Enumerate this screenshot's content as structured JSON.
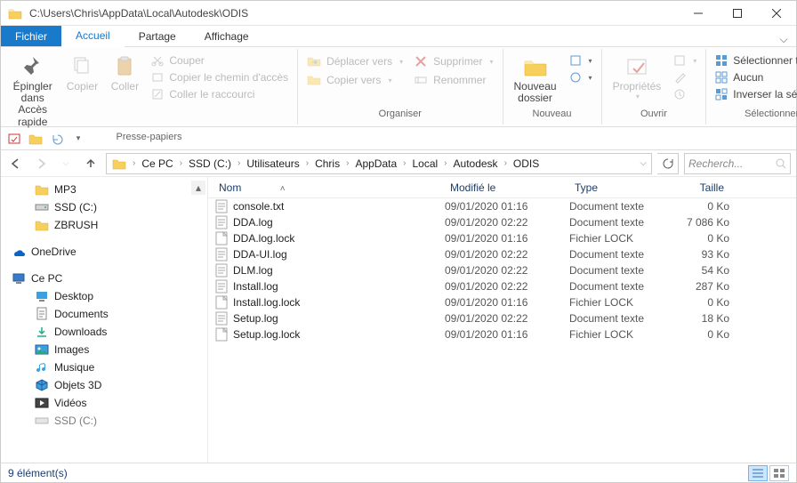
{
  "window": {
    "title": "C:\\Users\\Chris\\AppData\\Local\\Autodesk\\ODIS"
  },
  "tabs": {
    "file": "Fichier",
    "home": "Accueil",
    "share": "Partage",
    "view": "Affichage"
  },
  "ribbon": {
    "pin": "Épingler dans Accès rapide",
    "copy": "Copier",
    "paste": "Coller",
    "cut": "Couper",
    "copypath": "Copier le chemin d'accès",
    "pasteshortcut": "Coller le raccourci",
    "clipboard_group": "Presse-papiers",
    "moveto": "Déplacer vers",
    "copyto": "Copier vers",
    "delete": "Supprimer",
    "rename": "Renommer",
    "organize_group": "Organiser",
    "newfolder": "Nouveau dossier",
    "new_group": "Nouveau",
    "properties": "Propriétés",
    "open_group": "Ouvrir",
    "selectall": "Sélectionner tout",
    "selectnone": "Aucun",
    "invertsel": "Inverser la sélection",
    "select_group": "Sélectionner"
  },
  "breadcrumb": [
    "Ce PC",
    "SSD (C:)",
    "Utilisateurs",
    "Chris",
    "AppData",
    "Local",
    "Autodesk",
    "ODIS"
  ],
  "search_placeholder": "Recherch...",
  "nav": {
    "mp3": "MP3",
    "ssd": "SSD (C:)",
    "zbrush": "ZBRUSH",
    "onedrive": "OneDrive",
    "thispc": "Ce PC",
    "desktop": "Desktop",
    "documents": "Documents",
    "downloads": "Downloads",
    "images": "Images",
    "music": "Musique",
    "objects3d": "Objets 3D",
    "videos": "Vidéos",
    "ssd2": "SSD (C:)"
  },
  "columns": {
    "name": "Nom",
    "date": "Modifié le",
    "type": "Type",
    "size": "Taille"
  },
  "files": [
    {
      "name": "console.txt",
      "date": "09/01/2020 01:16",
      "type": "Document texte",
      "size": "0 Ko",
      "icon": "txt"
    },
    {
      "name": "DDA.log",
      "date": "09/01/2020 02:22",
      "type": "Document texte",
      "size": "7 086 Ko",
      "icon": "txt"
    },
    {
      "name": "DDA.log.lock",
      "date": "09/01/2020 01:16",
      "type": "Fichier LOCK",
      "size": "0 Ko",
      "icon": "blank"
    },
    {
      "name": "DDA-UI.log",
      "date": "09/01/2020 02:22",
      "type": "Document texte",
      "size": "93 Ko",
      "icon": "txt"
    },
    {
      "name": "DLM.log",
      "date": "09/01/2020 02:22",
      "type": "Document texte",
      "size": "54 Ko",
      "icon": "txt"
    },
    {
      "name": "Install.log",
      "date": "09/01/2020 02:22",
      "type": "Document texte",
      "size": "287 Ko",
      "icon": "txt"
    },
    {
      "name": "Install.log.lock",
      "date": "09/01/2020 01:16",
      "type": "Fichier LOCK",
      "size": "0 Ko",
      "icon": "blank"
    },
    {
      "name": "Setup.log",
      "date": "09/01/2020 02:22",
      "type": "Document texte",
      "size": "18 Ko",
      "icon": "txt"
    },
    {
      "name": "Setup.log.lock",
      "date": "09/01/2020 01:16",
      "type": "Fichier LOCK",
      "size": "0 Ko",
      "icon": "blank"
    }
  ],
  "status": "9 élément(s)"
}
